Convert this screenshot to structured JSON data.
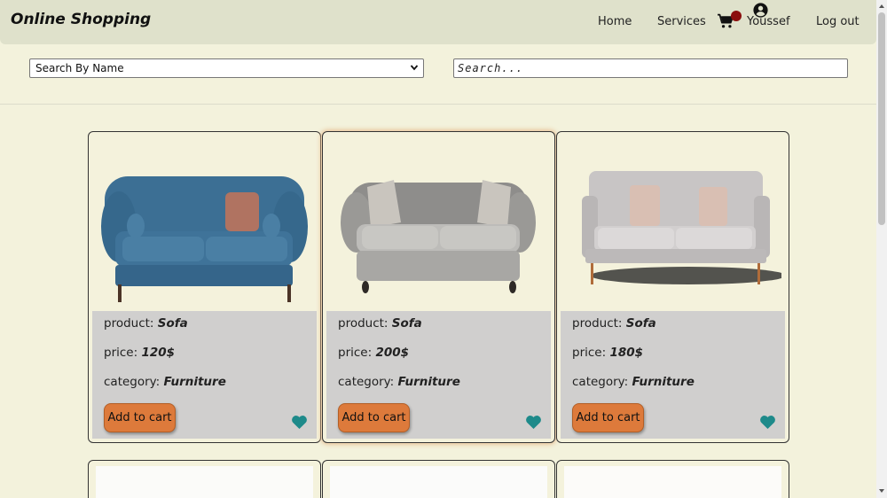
{
  "header": {
    "brand": "Online Shopping",
    "nav": {
      "home": "Home",
      "services": "Services",
      "logout": "Log out"
    },
    "user_name": "Youssef"
  },
  "filters": {
    "search_by_selected": "Search By Name",
    "search_placeholder": "Search..."
  },
  "colors": {
    "page_bg": "#f3f2dc",
    "navbar_bg": "#dfe1cb",
    "card_info_bg": "#d0cfce",
    "add_button": "#dd7a3b",
    "heart": "#1e8a8a",
    "cart_badge": "#8b0d0d"
  },
  "labels": {
    "product": "product: ",
    "price": "price: ",
    "category": "category: ",
    "add_to_cart": "Add to cart"
  },
  "products": [
    {
      "name": "Sofa",
      "price": "120$",
      "category": "Furniture",
      "image": "blue-tufted-sofa"
    },
    {
      "name": "Sofa",
      "price": "200$",
      "category": "Furniture",
      "image": "grey-tufted-sofa"
    },
    {
      "name": "Sofa",
      "price": "180$",
      "category": "Furniture",
      "image": "light-grey-modern-sofa"
    }
  ]
}
